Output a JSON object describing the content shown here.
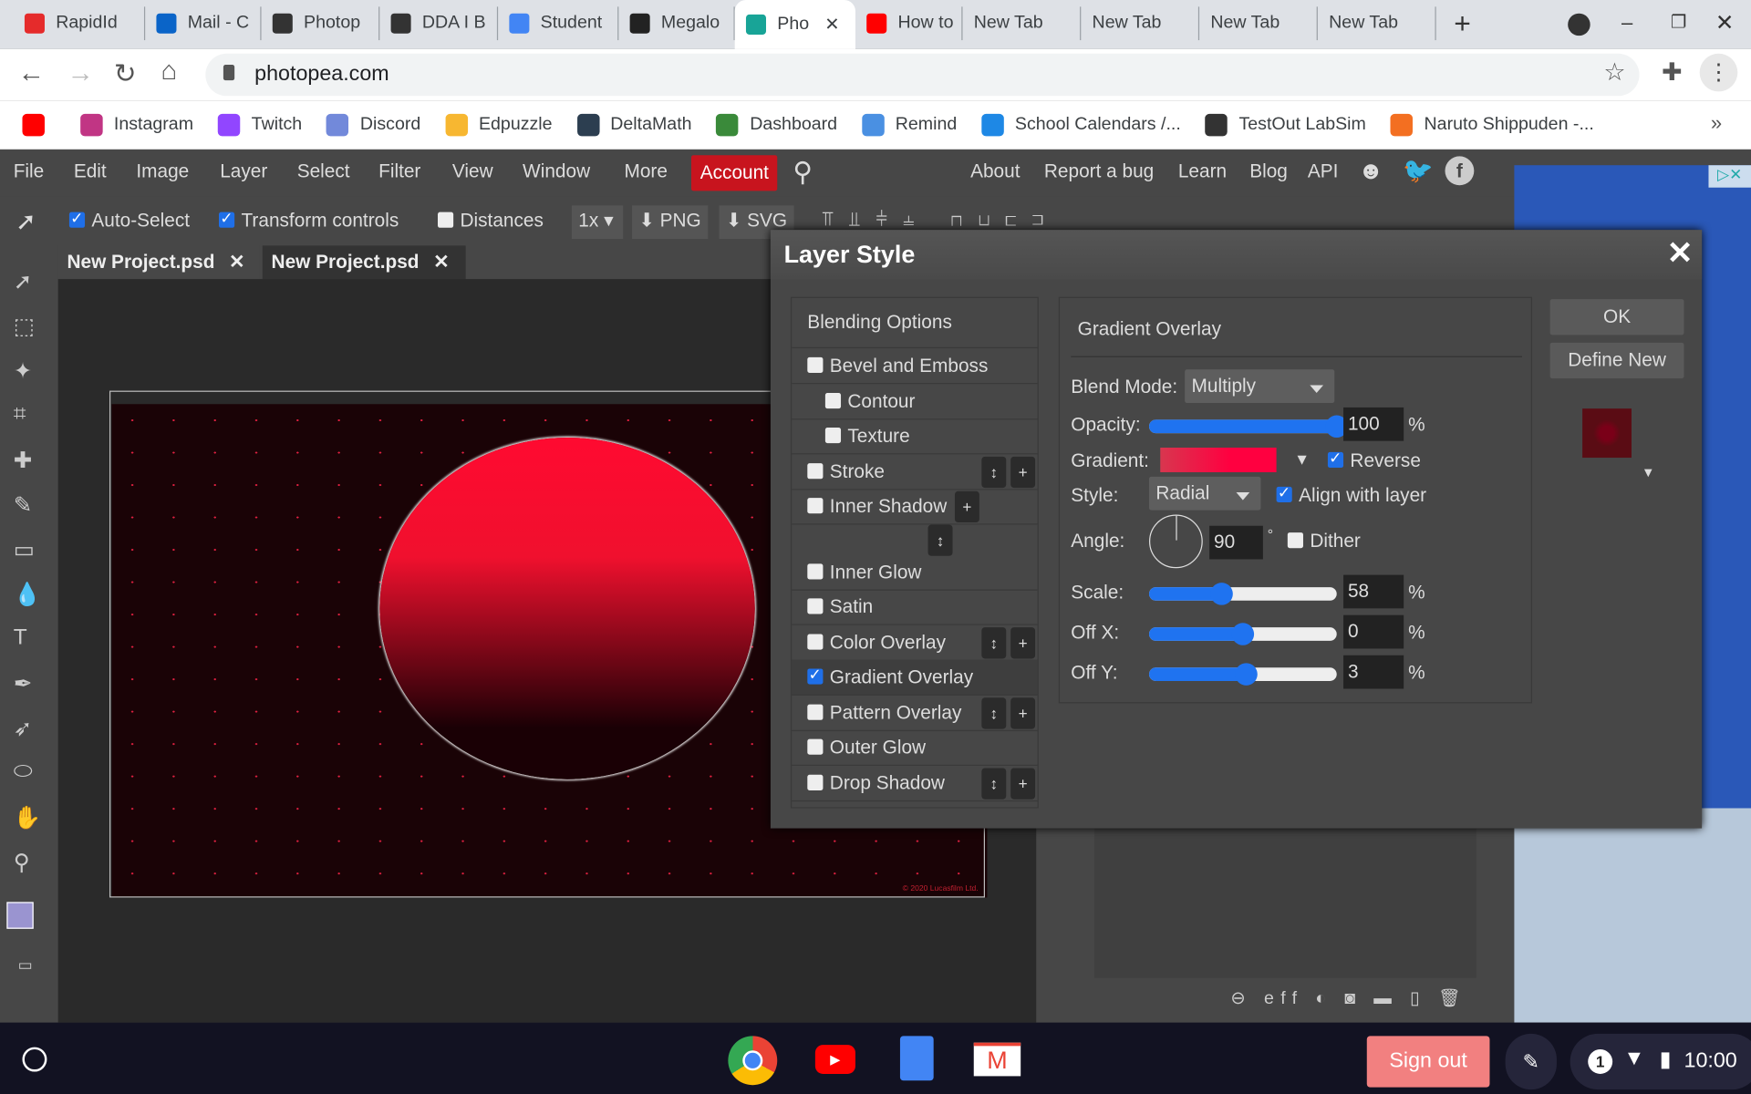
{
  "browser": {
    "tabs": [
      {
        "label": "RapidId",
        "color": "#e52b2b"
      },
      {
        "label": "Mail - C",
        "color": "#0a64c8"
      },
      {
        "label": "Photop",
        "color": "#333"
      },
      {
        "label": "DDA I B",
        "color": "#333"
      },
      {
        "label": "Student",
        "color": "#4285f4"
      },
      {
        "label": "Megalo",
        "color": "#222"
      },
      {
        "label": "Pho",
        "color": "#18a497",
        "active": true
      },
      {
        "label": "How to",
        "color": "#ff0000"
      },
      {
        "label": "New Tab"
      },
      {
        "label": "New Tab"
      },
      {
        "label": "New Tab"
      },
      {
        "label": "New Tab"
      }
    ],
    "url": "photopea.com",
    "bookmarks": [
      {
        "label": "",
        "color": "#ff0000"
      },
      {
        "label": "Instagram",
        "color": "#c13584"
      },
      {
        "label": "Twitch",
        "color": "#9146ff"
      },
      {
        "label": "Discord",
        "color": "#7289da"
      },
      {
        "label": "Edpuzzle",
        "color": "#f7b731"
      },
      {
        "label": "DeltaMath",
        "color": "#2c3e50"
      },
      {
        "label": "Dashboard",
        "color": "#3a8a3a"
      },
      {
        "label": "Remind",
        "color": "#4a90e2"
      },
      {
        "label": "School Calendars /...",
        "color": "#1e88e5"
      },
      {
        "label": "TestOut LabSim",
        "color": "#333"
      },
      {
        "label": "Naruto Shippuden -...",
        "color": "#f36f21"
      }
    ],
    "more_bookmarks": "»"
  },
  "menu": {
    "left": [
      "File",
      "Edit",
      "Image",
      "Layer",
      "Select",
      "Filter",
      "View",
      "Window",
      "More"
    ],
    "account": "Account",
    "right": [
      "About",
      "Report a bug",
      "Learn",
      "Blog",
      "API"
    ]
  },
  "options": {
    "auto_select": "Auto-Select",
    "transform": "Transform controls",
    "distances": "Distances",
    "zoom": "1x",
    "png": "PNG",
    "svg": "SVG"
  },
  "doc_tabs": [
    "New Project.psd",
    "New Project.psd"
  ],
  "canvas": {
    "copyright": "© 2020 Lucasfilm Ltd."
  },
  "dialog": {
    "title": "Layer Style",
    "styles": [
      {
        "label": "Blending Options",
        "checkbox": false
      },
      {
        "label": "Bevel and Emboss",
        "checked": false
      },
      {
        "label": "Contour",
        "checked": false,
        "indent": true
      },
      {
        "label": "Texture",
        "checked": false,
        "indent": true
      },
      {
        "label": "Stroke",
        "checked": false,
        "buttons": true
      },
      {
        "label": "Inner Shadow",
        "checked": false,
        "buttons": true
      },
      {
        "label": "Inner Glow",
        "checked": false
      },
      {
        "label": "Satin",
        "checked": false
      },
      {
        "label": "Color Overlay",
        "checked": false,
        "buttons": true
      },
      {
        "label": "Gradient Overlay",
        "checked": true
      },
      {
        "label": "Pattern Overlay",
        "checked": false,
        "buttons": true
      },
      {
        "label": "Outer Glow",
        "checked": false
      },
      {
        "label": "Drop Shadow",
        "checked": false,
        "buttons": true
      }
    ],
    "panel": {
      "title": "Gradient Overlay",
      "blend_mode_label": "Blend Mode:",
      "blend_mode": "Multiply",
      "opacity_label": "Opacity:",
      "opacity": "100",
      "gradient_label": "Gradient:",
      "gradient_colors": [
        "#d8364f",
        "#ff0040"
      ],
      "reverse": "Reverse",
      "reverse_checked": true,
      "style_label": "Style:",
      "style": "Radial",
      "align": "Align with layer",
      "align_checked": true,
      "angle_label": "Angle:",
      "angle": "90",
      "degree": "°",
      "dither": "Dither",
      "dither_checked": false,
      "scale_label": "Scale:",
      "scale": "58",
      "offx_label": "Off X:",
      "offx": "0",
      "offy_label": "Off Y:",
      "offy": "3",
      "percent": "%"
    },
    "ok": "OK",
    "define_new": "Define New",
    "preview_color": "#5a0c14"
  },
  "layers_footer": {
    "eff": "eff"
  },
  "taskbar": {
    "sign_out": "Sign out",
    "notifications": "1",
    "time": "10:00"
  }
}
